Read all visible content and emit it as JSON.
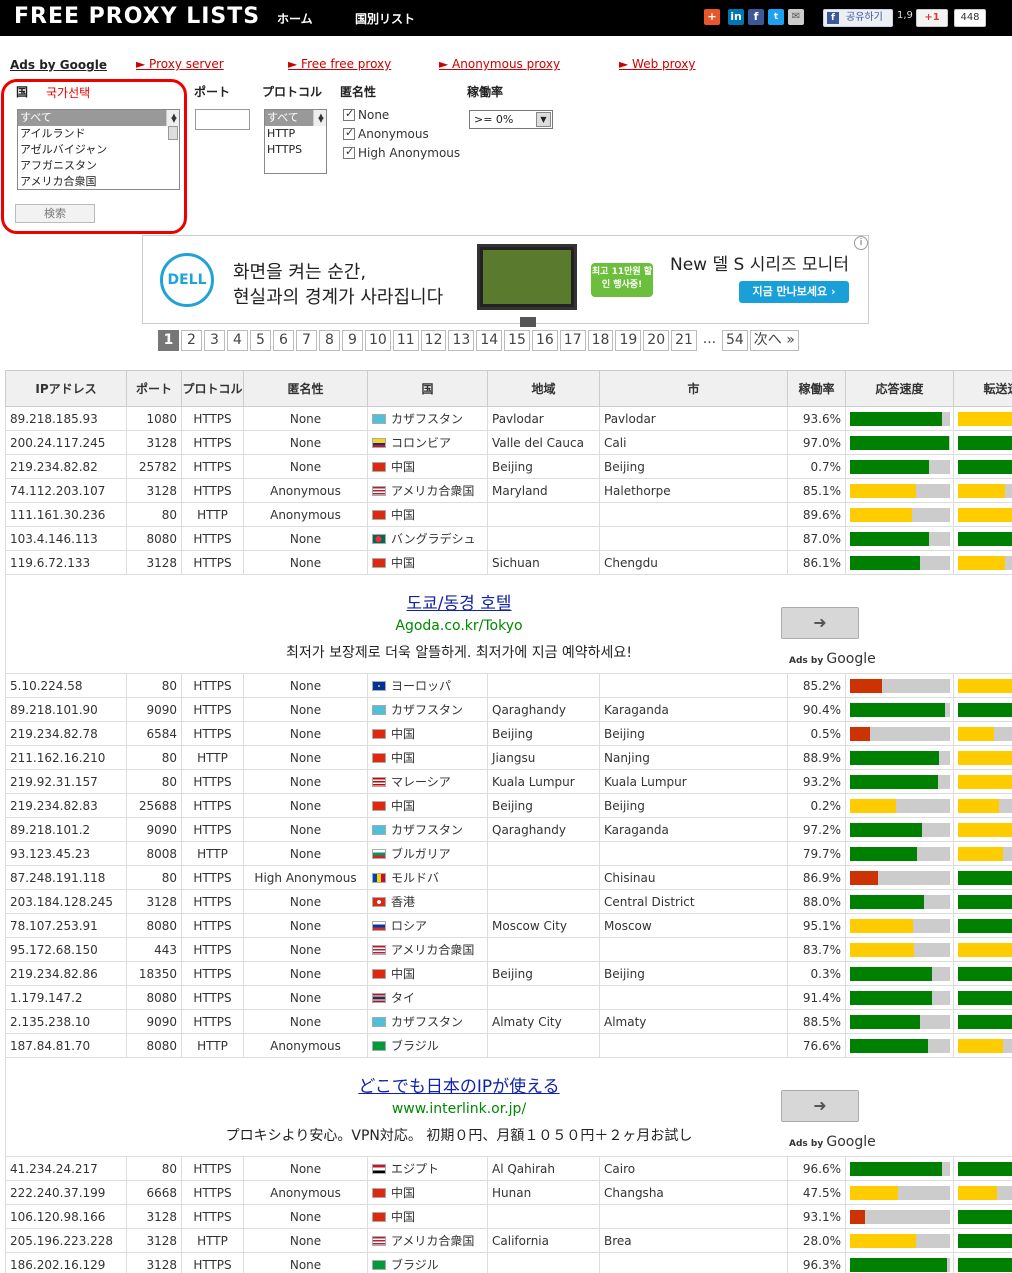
{
  "header": {
    "logo": "FREE PROXY LISTS",
    "nav": [
      {
        "label": "ホーム"
      },
      {
        "label": "国別リスト"
      }
    ],
    "fb_share": "공유하기",
    "fb_count": "1,9",
    "gplus": "+1",
    "gplus_count": "448"
  },
  "ads_bar": {
    "ads_by": "Ads by Google",
    "links": [
      {
        "label": "► Proxy server"
      },
      {
        "label": "► Free free proxy"
      },
      {
        "label": "► Anonymous proxy"
      },
      {
        "label": "► Web proxy"
      }
    ]
  },
  "filters": {
    "country_label": "国",
    "country_annotation": "국가선택",
    "countries": [
      "すべて",
      "アイルランド",
      "アゼルバイジャン",
      "アフガニスタン",
      "アメリカ合衆国"
    ],
    "port_label": "ポート",
    "port_value": "",
    "protocol_label": "プロトコル",
    "protocols": [
      "すべて",
      "HTTP",
      "HTTPS"
    ],
    "anonymity_label": "匿名性",
    "anonymity_options": [
      "None",
      "Anonymous",
      "High Anonymous"
    ],
    "uptime_label": "稼働率",
    "uptime_value": ">= 0%",
    "search_button": "検索"
  },
  "banner": {
    "brand": "DELL",
    "line1": "화면을 켜는 순간,",
    "line2": "현실과의 경계가 사라집니다",
    "promo": "최고 11만원 할인 행사중!",
    "headline": "New 델 S 시리즈 모니터",
    "cta": "지금 만나보세요 ›",
    "info_icon": "i"
  },
  "pagination": {
    "pages": [
      "1",
      "2",
      "3",
      "4",
      "5",
      "6",
      "7",
      "8",
      "9",
      "10",
      "11",
      "12",
      "13",
      "14",
      "15",
      "16",
      "17",
      "18",
      "19",
      "20",
      "21"
    ],
    "ellipsis": "...",
    "last": "54",
    "next": "次へ »",
    "active": "1"
  },
  "table": {
    "headers": [
      "IPアドレス",
      "ポート",
      "プロトコル",
      "匿名性",
      "国",
      "地域",
      "市",
      "稼働率",
      "応答速度",
      "転送速度"
    ],
    "colors": {
      "green": "#008000",
      "yellow": "#ffcc00",
      "red": "#cc3300",
      "track": "#cccccc"
    },
    "rows_a": [
      {
        "ip": "89.218.185.93",
        "port": "1080",
        "protocol": "HTTPS",
        "anonymity": "None",
        "country": "カザフスタン",
        "flag": "kz",
        "region": "Pavlodar",
        "city": "Pavlodar",
        "uptime": "93.6%",
        "response": 0.92,
        "response_color": "green",
        "transfer": 0.62,
        "transfer_color": "yellow"
      },
      {
        "ip": "200.24.117.245",
        "port": "3128",
        "protocol": "HTTPS",
        "anonymity": "None",
        "country": "コロンビア",
        "flag": "co",
        "region": "Valle del Cauca",
        "city": "Cali",
        "uptime": "97.0%",
        "response": 0.99,
        "response_color": "green",
        "transfer": 1.0,
        "transfer_color": "green"
      },
      {
        "ip": "219.234.82.82",
        "port": "25782",
        "protocol": "HTTPS",
        "anonymity": "None",
        "country": "中国",
        "flag": "cn",
        "region": "Beijing",
        "city": "Beijing",
        "uptime": "0.7%",
        "response": 0.79,
        "response_color": "green",
        "transfer": 0.72,
        "transfer_color": "green"
      },
      {
        "ip": "74.112.203.107",
        "port": "3128",
        "protocol": "HTTPS",
        "anonymity": "Anonymous",
        "country": "アメリカ合衆国",
        "flag": "us",
        "region": "Maryland",
        "city": "Halethorpe",
        "uptime": "85.1%",
        "response": 0.66,
        "response_color": "yellow",
        "transfer": 0.47,
        "transfer_color": "yellow"
      },
      {
        "ip": "111.161.30.236",
        "port": "80",
        "protocol": "HTTP",
        "anonymity": "Anonymous",
        "country": "中国",
        "flag": "cn",
        "region": "",
        "city": "",
        "uptime": "89.6%",
        "response": 0.62,
        "response_color": "yellow",
        "transfer": 0.6,
        "transfer_color": "yellow"
      },
      {
        "ip": "103.4.146.113",
        "port": "8080",
        "protocol": "HTTPS",
        "anonymity": "None",
        "country": "バングラデシュ",
        "flag": "bd",
        "region": "",
        "city": "",
        "uptime": "87.0%",
        "response": 0.79,
        "response_color": "green",
        "transfer": 0.93,
        "transfer_color": "green"
      },
      {
        "ip": "119.6.72.133",
        "port": "3128",
        "protocol": "HTTPS",
        "anonymity": "None",
        "country": "中国",
        "flag": "cn",
        "region": "Sichuan",
        "city": "Chengdu",
        "uptime": "86.1%",
        "response": 0.7,
        "response_color": "green",
        "transfer": 0.47,
        "transfer_color": "yellow"
      }
    ],
    "ad1": {
      "title": "도쿄/동경 호텔",
      "url": "Agoda.co.kr/Tokyo",
      "text": "최저가 보장제로 더욱 알뜰하게. 최저가에 지금 예약하세요!",
      "ads_by": "Ads by",
      "google": "Google",
      "button": "➜"
    },
    "rows_b": [
      {
        "ip": "5.10.224.58",
        "port": "80",
        "protocol": "HTTPS",
        "anonymity": "None",
        "country": "ヨーロッパ",
        "flag": "eu",
        "region": "",
        "city": "",
        "uptime": "85.2%",
        "response": 0.32,
        "response_color": "red",
        "transfer": 0.64,
        "transfer_color": "yellow"
      },
      {
        "ip": "89.218.101.90",
        "port": "9090",
        "protocol": "HTTPS",
        "anonymity": "None",
        "country": "カザフスタン",
        "flag": "kz",
        "region": "Qaraghandy",
        "city": "Karaganda",
        "uptime": "90.4%",
        "response": 0.95,
        "response_color": "green",
        "transfer": 0.8,
        "transfer_color": "green"
      },
      {
        "ip": "219.234.82.78",
        "port": "6584",
        "protocol": "HTTPS",
        "anonymity": "None",
        "country": "中国",
        "flag": "cn",
        "region": "Beijing",
        "city": "Beijing",
        "uptime": "0.5%",
        "response": 0.2,
        "response_color": "red",
        "transfer": 0.36,
        "transfer_color": "yellow"
      },
      {
        "ip": "211.162.16.210",
        "port": "80",
        "protocol": "HTTP",
        "anonymity": "None",
        "country": "中国",
        "flag": "cn",
        "region": "Jiangsu",
        "city": "Nanjing",
        "uptime": "88.9%",
        "response": 0.89,
        "response_color": "green",
        "transfer": 0.6,
        "transfer_color": "yellow"
      },
      {
        "ip": "219.92.31.157",
        "port": "80",
        "protocol": "HTTPS",
        "anonymity": "None",
        "country": "マレーシア",
        "flag": "my",
        "region": "Kuala Lumpur",
        "city": "Kuala Lumpur",
        "uptime": "93.2%",
        "response": 0.88,
        "response_color": "green",
        "transfer": 0.66,
        "transfer_color": "yellow"
      },
      {
        "ip": "219.234.82.83",
        "port": "25688",
        "protocol": "HTTPS",
        "anonymity": "None",
        "country": "中国",
        "flag": "cn",
        "region": "Beijing",
        "city": "Beijing",
        "uptime": "0.2%",
        "response": 0.46,
        "response_color": "yellow",
        "transfer": 0.41,
        "transfer_color": "yellow"
      },
      {
        "ip": "89.218.101.2",
        "port": "9090",
        "protocol": "HTTPS",
        "anonymity": "None",
        "country": "カザフスタン",
        "flag": "kz",
        "region": "Qaraghandy",
        "city": "Karaganda",
        "uptime": "97.2%",
        "response": 0.72,
        "response_color": "green",
        "transfer": 0.66,
        "transfer_color": "yellow"
      },
      {
        "ip": "93.123.45.23",
        "port": "8008",
        "protocol": "HTTP",
        "anonymity": "None",
        "country": "ブルガリア",
        "flag": "bg",
        "region": "",
        "city": "",
        "uptime": "79.7%",
        "response": 0.67,
        "response_color": "green",
        "transfer": 0.45,
        "transfer_color": "yellow"
      },
      {
        "ip": "87.248.191.118",
        "port": "80",
        "protocol": "HTTPS",
        "anonymity": "High Anonymous",
        "country": "モルドバ",
        "flag": "md",
        "region": "",
        "city": "Chisinau",
        "uptime": "86.9%",
        "response": 0.28,
        "response_color": "red",
        "transfer": 0.96,
        "transfer_color": "green"
      },
      {
        "ip": "203.184.128.245",
        "port": "3128",
        "protocol": "HTTPS",
        "anonymity": "None",
        "country": "香港",
        "flag": "hk",
        "region": "",
        "city": "Central District",
        "uptime": "88.0%",
        "response": 0.74,
        "response_color": "green",
        "transfer": 0.92,
        "transfer_color": "green"
      },
      {
        "ip": "78.107.253.91",
        "port": "8080",
        "protocol": "HTTPS",
        "anonymity": "None",
        "country": "ロシア",
        "flag": "ru",
        "region": "Moscow City",
        "city": "Moscow",
        "uptime": "95.1%",
        "response": 0.63,
        "response_color": "yellow",
        "transfer": 0.69,
        "transfer_color": "green"
      },
      {
        "ip": "95.172.68.150",
        "port": "443",
        "protocol": "HTTPS",
        "anonymity": "None",
        "country": "アメリカ合衆国",
        "flag": "us",
        "region": "",
        "city": "",
        "uptime": "83.7%",
        "response": 0.64,
        "response_color": "yellow",
        "transfer": 0.55,
        "transfer_color": "yellow"
      },
      {
        "ip": "219.234.82.86",
        "port": "18350",
        "protocol": "HTTPS",
        "anonymity": "None",
        "country": "中国",
        "flag": "cn",
        "region": "Beijing",
        "city": "Beijing",
        "uptime": "0.3%",
        "response": 0.82,
        "response_color": "green",
        "transfer": 0.72,
        "transfer_color": "green"
      },
      {
        "ip": "1.179.147.2",
        "port": "8080",
        "protocol": "HTTPS",
        "anonymity": "None",
        "country": "タイ",
        "flag": "th",
        "region": "",
        "city": "",
        "uptime": "91.4%",
        "response": 0.82,
        "response_color": "green",
        "transfer": 0.85,
        "transfer_color": "green"
      },
      {
        "ip": "2.135.238.10",
        "port": "9090",
        "protocol": "HTTPS",
        "anonymity": "None",
        "country": "カザフスタン",
        "flag": "kz",
        "region": "Almaty City",
        "city": "Almaty",
        "uptime": "88.5%",
        "response": 0.7,
        "response_color": "green",
        "transfer": 0.96,
        "transfer_color": "green"
      },
      {
        "ip": "187.84.81.70",
        "port": "8080",
        "protocol": "HTTP",
        "anonymity": "Anonymous",
        "country": "ブラジル",
        "flag": "br",
        "region": "",
        "city": "",
        "uptime": "76.6%",
        "response": 0.78,
        "response_color": "green",
        "transfer": 0.45,
        "transfer_color": "yellow"
      }
    ],
    "ad2": {
      "title": "どこでも日本のIPが使える",
      "url": "www.interlink.or.jp/",
      "text": "プロキシより安心。VPN対応。 初期０円、月額１０５０円＋２ヶ月お試し",
      "ads_by": "Ads by",
      "google": "Google",
      "button": "➜"
    },
    "rows_c": [
      {
        "ip": "41.234.24.217",
        "port": "80",
        "protocol": "HTTPS",
        "anonymity": "None",
        "country": "エジプト",
        "flag": "eg",
        "region": "Al Qahirah",
        "city": "Cairo",
        "uptime": "96.6%",
        "response": 0.92,
        "response_color": "green",
        "transfer": 0.82,
        "transfer_color": "green"
      },
      {
        "ip": "222.240.37.199",
        "port": "6668",
        "protocol": "HTTPS",
        "anonymity": "Anonymous",
        "country": "中国",
        "flag": "cn",
        "region": "Hunan",
        "city": "Changsha",
        "uptime": "47.5%",
        "response": 0.48,
        "response_color": "yellow",
        "transfer": 0.39,
        "transfer_color": "yellow"
      },
      {
        "ip": "106.120.98.166",
        "port": "3128",
        "protocol": "HTTPS",
        "anonymity": "None",
        "country": "中国",
        "flag": "cn",
        "region": "",
        "city": "",
        "uptime": "93.1%",
        "response": 0.15,
        "response_color": "red",
        "transfer": 0.68,
        "transfer_color": "green"
      },
      {
        "ip": "205.196.223.228",
        "port": "3128",
        "protocol": "HTTP",
        "anonymity": "None",
        "country": "アメリカ合衆国",
        "flag": "us",
        "region": "California",
        "city": "Brea",
        "uptime": "28.0%",
        "response": 0.66,
        "response_color": "yellow",
        "transfer": 0.85,
        "transfer_color": "green"
      },
      {
        "ip": "186.202.16.129",
        "port": "3128",
        "protocol": "HTTPS",
        "anonymity": "None",
        "country": "ブラジル",
        "flag": "br",
        "region": "",
        "city": "",
        "uptime": "96.3%",
        "response": 0.97,
        "response_color": "green",
        "transfer": 0.7,
        "transfer_color": "green"
      }
    ]
  }
}
